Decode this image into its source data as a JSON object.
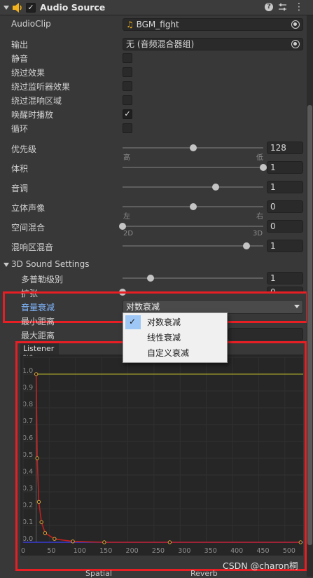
{
  "header": {
    "title": "Audio Source",
    "enabled_mark": "✓",
    "help_icon": "help-icon",
    "presets_icon": "sliders-icon",
    "more_icon": "kebab-icon"
  },
  "audioclip": {
    "label": "AudioClip",
    "value": "BGM_fight"
  },
  "output": {
    "label": "输出",
    "value": "无 (音频混合器组)"
  },
  "toggles": [
    {
      "label": "静音",
      "checked": false
    },
    {
      "label": "绕过效果",
      "checked": false
    },
    {
      "label": "绕过监听器效果",
      "checked": false
    },
    {
      "label": "绕过混响区域",
      "checked": false
    },
    {
      "label": "唤醒时播放",
      "checked": true,
      "mark": "✓"
    },
    {
      "label": "循环",
      "checked": false
    }
  ],
  "sliders": {
    "priority": {
      "label": "优先级",
      "value": "128",
      "level": 0.5,
      "min_label": "高",
      "max_label": "低"
    },
    "volume": {
      "label": "体积",
      "value": "1",
      "level": 1.0
    },
    "pitch": {
      "label": "音调",
      "value": "1",
      "level": 0.66
    },
    "stereo_pan": {
      "label": "立体声像",
      "value": "0",
      "level": 0.5,
      "min_label": "左",
      "max_label": "右"
    },
    "spatial_blend": {
      "label": "空间混合",
      "value": "0",
      "level": 0.0,
      "min_label": "2D",
      "max_label": "3D"
    },
    "reverb_mix": {
      "label": "混响区混音",
      "value": "1",
      "level": 0.88
    }
  },
  "sound3d": {
    "title": "3D Sound Settings",
    "doppler": {
      "label": "多普勒级别",
      "value": "1",
      "level": 0.2
    },
    "spread": {
      "label": "扩张",
      "value": "0",
      "level": 0.0
    },
    "rolloff": {
      "label": "音量衰减",
      "value": "对数衰减"
    },
    "min_distance": {
      "label": "最小距离"
    },
    "max_distance": {
      "label": "最大距离"
    }
  },
  "rolloff_menu": {
    "items": [
      "对数衰减",
      "线性衰减",
      "自定义衰减"
    ],
    "selected_index": 0,
    "check_mark": "✓"
  },
  "graph": {
    "legend_label": "Listener",
    "y_ticks": [
      "1.1",
      "1.0",
      "0.9",
      "0.8",
      "0.7",
      "0.6",
      "0.5",
      "0.4",
      "0.3",
      "0.2",
      "0.1",
      "0.0"
    ],
    "x_ticks": [
      "0",
      "50",
      "100",
      "150",
      "200",
      "250",
      "300",
      "350",
      "400",
      "450",
      "500"
    ],
    "bottom_labels": [
      "Spatial",
      "Reverb"
    ],
    "colors": {
      "volume": "#c0201f",
      "listener": "#8c8a2a",
      "spatial": "#3a3ad6",
      "keys": "#e0a83a"
    },
    "volume_keys": [
      {
        "x": 25,
        "y": 1.0
      },
      {
        "x": 27,
        "y": 0.5
      },
      {
        "x": 30,
        "y": 0.24
      },
      {
        "x": 35,
        "y": 0.12
      },
      {
        "x": 42,
        "y": 0.055
      },
      {
        "x": 60,
        "y": 0.02
      },
      {
        "x": 95,
        "y": 0.005
      },
      {
        "x": 155,
        "y": 0.0
      },
      {
        "x": 280,
        "y": 0.0
      },
      {
        "x": 530,
        "y": 0.0
      }
    ]
  },
  "watermark": "CSDN @charon桐"
}
